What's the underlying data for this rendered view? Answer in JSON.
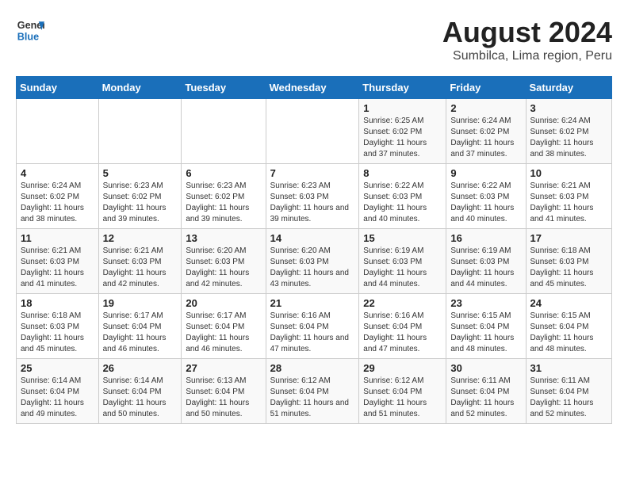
{
  "header": {
    "logo_line1": "General",
    "logo_line2": "Blue",
    "title": "August 2024",
    "subtitle": "Sumbilca, Lima region, Peru"
  },
  "weekdays": [
    "Sunday",
    "Monday",
    "Tuesday",
    "Wednesday",
    "Thursday",
    "Friday",
    "Saturday"
  ],
  "weeks": [
    [
      {
        "day": "",
        "sunrise": "",
        "sunset": "",
        "daylight": ""
      },
      {
        "day": "",
        "sunrise": "",
        "sunset": "",
        "daylight": ""
      },
      {
        "day": "",
        "sunrise": "",
        "sunset": "",
        "daylight": ""
      },
      {
        "day": "",
        "sunrise": "",
        "sunset": "",
        "daylight": ""
      },
      {
        "day": "1",
        "sunrise": "Sunrise: 6:25 AM",
        "sunset": "Sunset: 6:02 PM",
        "daylight": "Daylight: 11 hours and 37 minutes."
      },
      {
        "day": "2",
        "sunrise": "Sunrise: 6:24 AM",
        "sunset": "Sunset: 6:02 PM",
        "daylight": "Daylight: 11 hours and 37 minutes."
      },
      {
        "day": "3",
        "sunrise": "Sunrise: 6:24 AM",
        "sunset": "Sunset: 6:02 PM",
        "daylight": "Daylight: 11 hours and 38 minutes."
      }
    ],
    [
      {
        "day": "4",
        "sunrise": "Sunrise: 6:24 AM",
        "sunset": "Sunset: 6:02 PM",
        "daylight": "Daylight: 11 hours and 38 minutes."
      },
      {
        "day": "5",
        "sunrise": "Sunrise: 6:23 AM",
        "sunset": "Sunset: 6:02 PM",
        "daylight": "Daylight: 11 hours and 39 minutes."
      },
      {
        "day": "6",
        "sunrise": "Sunrise: 6:23 AM",
        "sunset": "Sunset: 6:02 PM",
        "daylight": "Daylight: 11 hours and 39 minutes."
      },
      {
        "day": "7",
        "sunrise": "Sunrise: 6:23 AM",
        "sunset": "Sunset: 6:03 PM",
        "daylight": "Daylight: 11 hours and 39 minutes."
      },
      {
        "day": "8",
        "sunrise": "Sunrise: 6:22 AM",
        "sunset": "Sunset: 6:03 PM",
        "daylight": "Daylight: 11 hours and 40 minutes."
      },
      {
        "day": "9",
        "sunrise": "Sunrise: 6:22 AM",
        "sunset": "Sunset: 6:03 PM",
        "daylight": "Daylight: 11 hours and 40 minutes."
      },
      {
        "day": "10",
        "sunrise": "Sunrise: 6:21 AM",
        "sunset": "Sunset: 6:03 PM",
        "daylight": "Daylight: 11 hours and 41 minutes."
      }
    ],
    [
      {
        "day": "11",
        "sunrise": "Sunrise: 6:21 AM",
        "sunset": "Sunset: 6:03 PM",
        "daylight": "Daylight: 11 hours and 41 minutes."
      },
      {
        "day": "12",
        "sunrise": "Sunrise: 6:21 AM",
        "sunset": "Sunset: 6:03 PM",
        "daylight": "Daylight: 11 hours and 42 minutes."
      },
      {
        "day": "13",
        "sunrise": "Sunrise: 6:20 AM",
        "sunset": "Sunset: 6:03 PM",
        "daylight": "Daylight: 11 hours and 42 minutes."
      },
      {
        "day": "14",
        "sunrise": "Sunrise: 6:20 AM",
        "sunset": "Sunset: 6:03 PM",
        "daylight": "Daylight: 11 hours and 43 minutes."
      },
      {
        "day": "15",
        "sunrise": "Sunrise: 6:19 AM",
        "sunset": "Sunset: 6:03 PM",
        "daylight": "Daylight: 11 hours and 44 minutes."
      },
      {
        "day": "16",
        "sunrise": "Sunrise: 6:19 AM",
        "sunset": "Sunset: 6:03 PM",
        "daylight": "Daylight: 11 hours and 44 minutes."
      },
      {
        "day": "17",
        "sunrise": "Sunrise: 6:18 AM",
        "sunset": "Sunset: 6:03 PM",
        "daylight": "Daylight: 11 hours and 45 minutes."
      }
    ],
    [
      {
        "day": "18",
        "sunrise": "Sunrise: 6:18 AM",
        "sunset": "Sunset: 6:03 PM",
        "daylight": "Daylight: 11 hours and 45 minutes."
      },
      {
        "day": "19",
        "sunrise": "Sunrise: 6:17 AM",
        "sunset": "Sunset: 6:04 PM",
        "daylight": "Daylight: 11 hours and 46 minutes."
      },
      {
        "day": "20",
        "sunrise": "Sunrise: 6:17 AM",
        "sunset": "Sunset: 6:04 PM",
        "daylight": "Daylight: 11 hours and 46 minutes."
      },
      {
        "day": "21",
        "sunrise": "Sunrise: 6:16 AM",
        "sunset": "Sunset: 6:04 PM",
        "daylight": "Daylight: 11 hours and 47 minutes."
      },
      {
        "day": "22",
        "sunrise": "Sunrise: 6:16 AM",
        "sunset": "Sunset: 6:04 PM",
        "daylight": "Daylight: 11 hours and 47 minutes."
      },
      {
        "day": "23",
        "sunrise": "Sunrise: 6:15 AM",
        "sunset": "Sunset: 6:04 PM",
        "daylight": "Daylight: 11 hours and 48 minutes."
      },
      {
        "day": "24",
        "sunrise": "Sunrise: 6:15 AM",
        "sunset": "Sunset: 6:04 PM",
        "daylight": "Daylight: 11 hours and 48 minutes."
      }
    ],
    [
      {
        "day": "25",
        "sunrise": "Sunrise: 6:14 AM",
        "sunset": "Sunset: 6:04 PM",
        "daylight": "Daylight: 11 hours and 49 minutes."
      },
      {
        "day": "26",
        "sunrise": "Sunrise: 6:14 AM",
        "sunset": "Sunset: 6:04 PM",
        "daylight": "Daylight: 11 hours and 50 minutes."
      },
      {
        "day": "27",
        "sunrise": "Sunrise: 6:13 AM",
        "sunset": "Sunset: 6:04 PM",
        "daylight": "Daylight: 11 hours and 50 minutes."
      },
      {
        "day": "28",
        "sunrise": "Sunrise: 6:12 AM",
        "sunset": "Sunset: 6:04 PM",
        "daylight": "Daylight: 11 hours and 51 minutes."
      },
      {
        "day": "29",
        "sunrise": "Sunrise: 6:12 AM",
        "sunset": "Sunset: 6:04 PM",
        "daylight": "Daylight: 11 hours and 51 minutes."
      },
      {
        "day": "30",
        "sunrise": "Sunrise: 6:11 AM",
        "sunset": "Sunset: 6:04 PM",
        "daylight": "Daylight: 11 hours and 52 minutes."
      },
      {
        "day": "31",
        "sunrise": "Sunrise: 6:11 AM",
        "sunset": "Sunset: 6:04 PM",
        "daylight": "Daylight: 11 hours and 52 minutes."
      }
    ]
  ]
}
